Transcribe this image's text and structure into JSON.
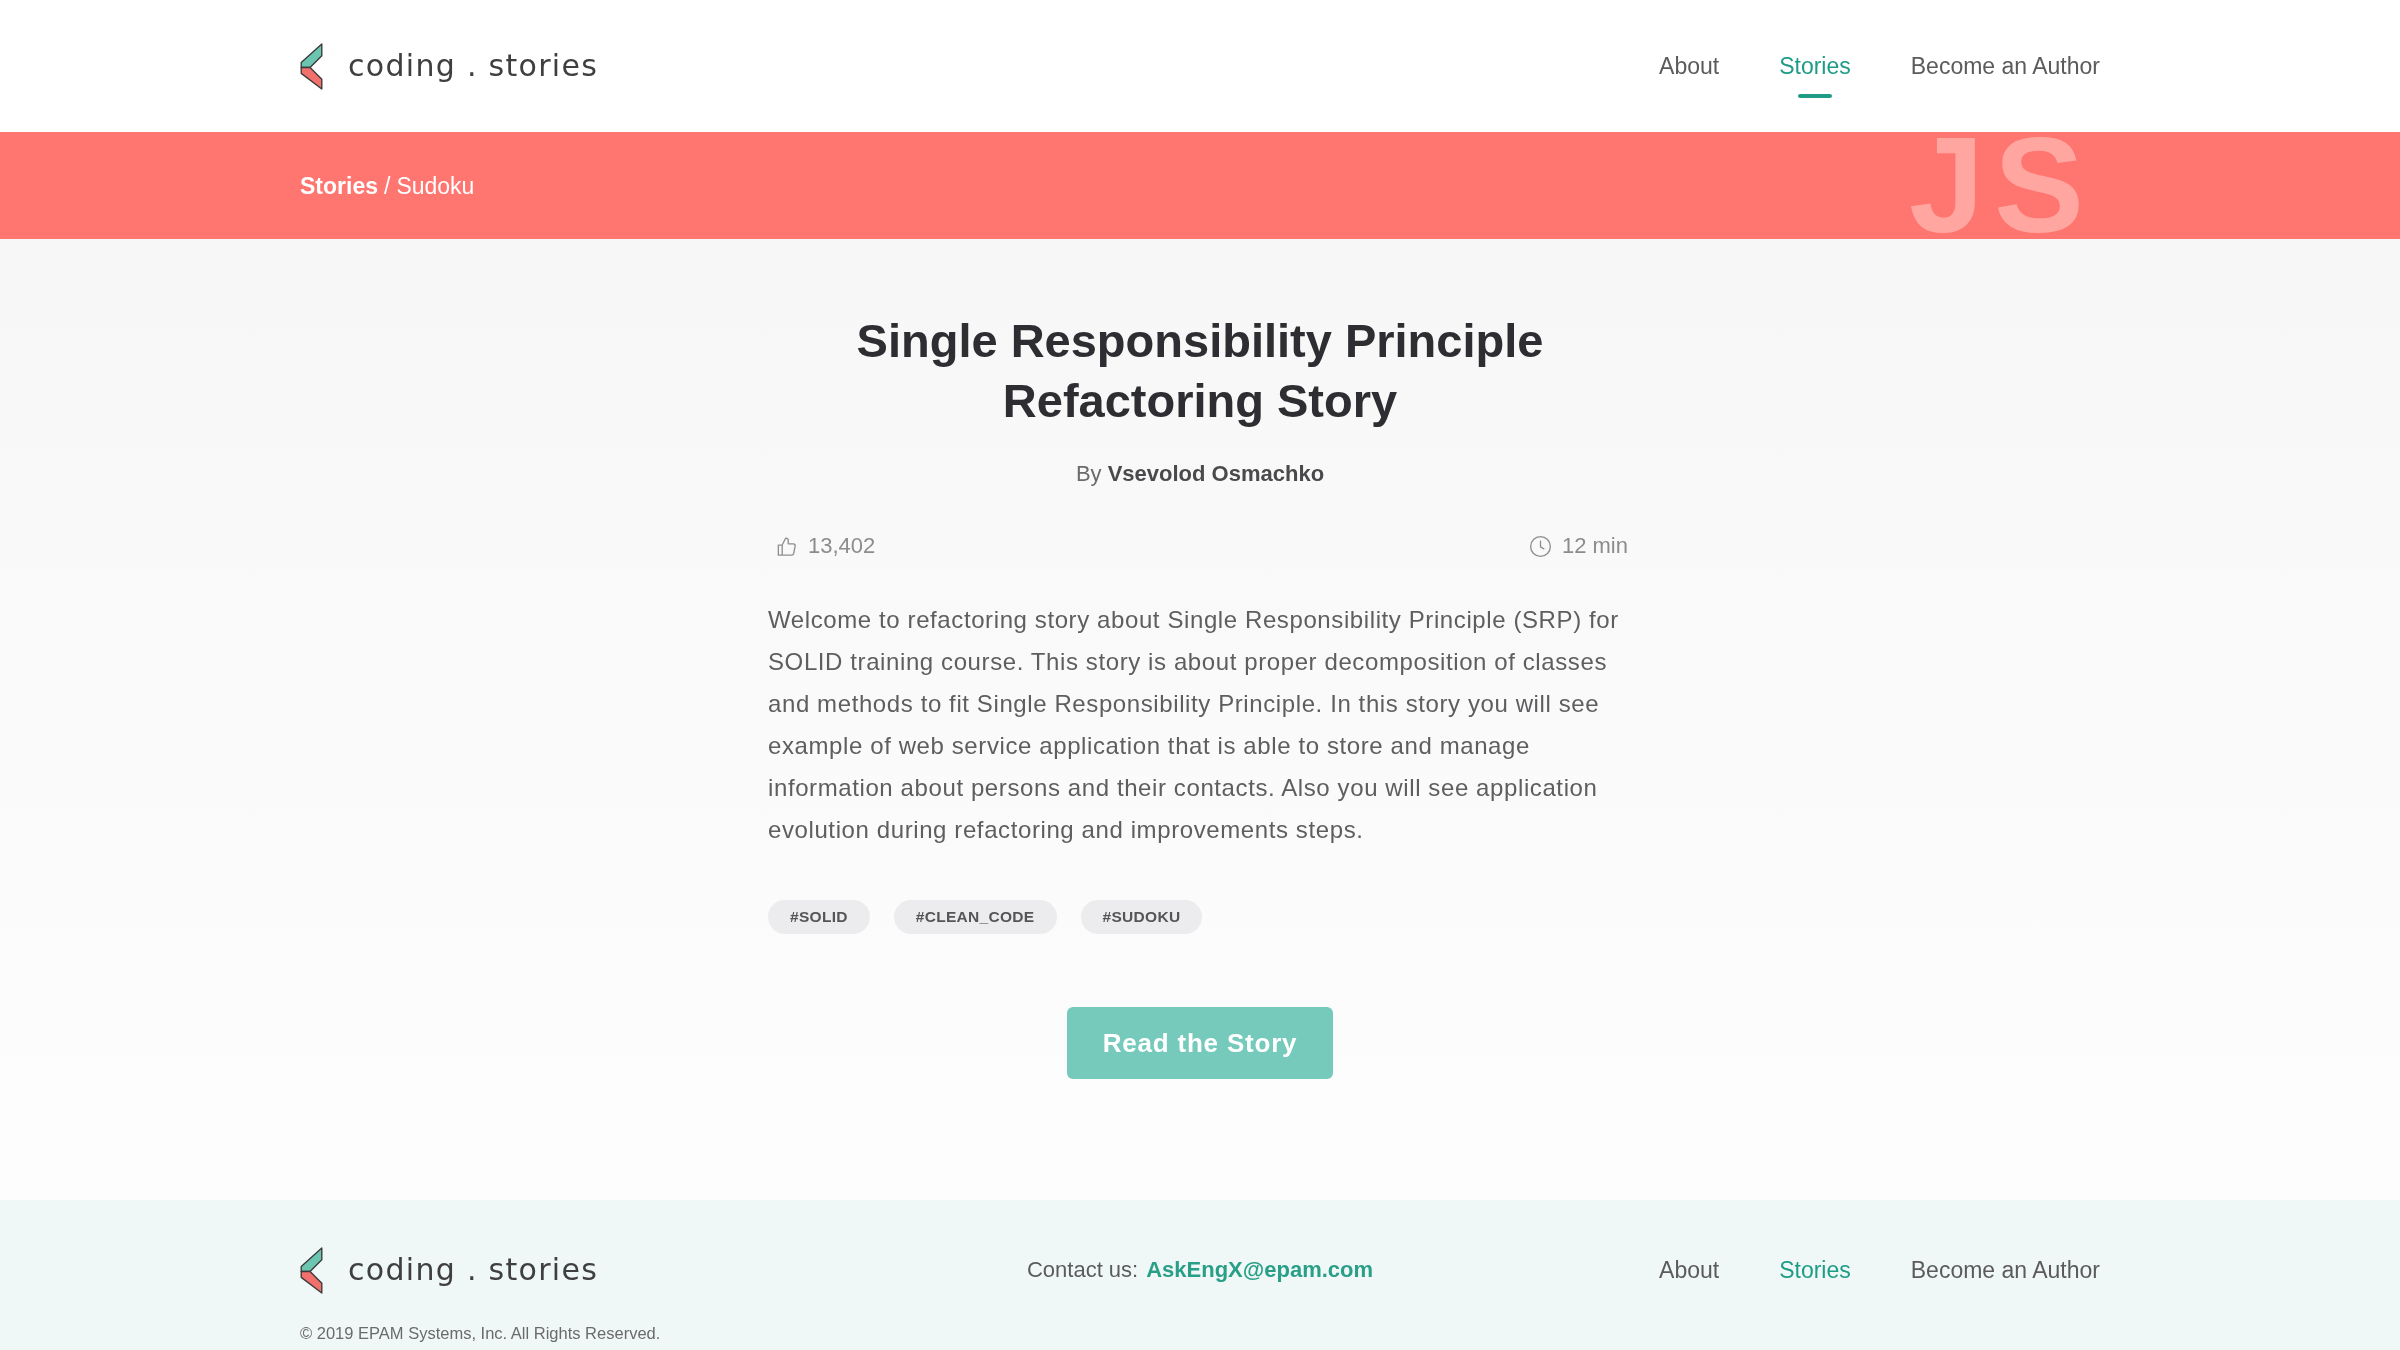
{
  "header": {
    "logo_text": "coding . stories",
    "nav": [
      {
        "label": "About",
        "selected": false
      },
      {
        "label": "Stories",
        "selected": true
      },
      {
        "label": "Become an Author",
        "selected": false
      }
    ]
  },
  "banner": {
    "breadcrumb": [
      {
        "label": "Stories",
        "current": false
      },
      {
        "label": "Sudoku",
        "current": true
      }
    ],
    "separator": "/",
    "language_mark": "JS"
  },
  "story": {
    "title": "Single Responsibility Principle Refactoring Story",
    "byline": "By **Vsevolod Osmachko**",
    "likes": "13,402",
    "read_time": "12 min",
    "description": "Welcome to refactoring story about Single Responsibility Principle (SRP) for SOLID training course. This story is about proper decomposition of classes and methods to fit Single Responsibility Principle. In this story you will see example of web service application that is able to store and manage information about persons and their contacts. Also you will see application evolution during refactoring and improvements steps.",
    "tags": [
      "#SOLID",
      "#CLEAN_CODE",
      "#SUDOKU"
    ],
    "read_button": "Read the Story"
  },
  "footer": {
    "logo_text": "coding . stories",
    "contact_label": "Contact us:",
    "contact_email": "AskEngX@epam.com",
    "nav": [
      {
        "label": "About",
        "selected": false
      },
      {
        "label": "Stories",
        "selected": true
      },
      {
        "label": "Become an Author",
        "selected": false
      }
    ],
    "copyright": "© 2019 EPAM Systems, Inc. All Rights Reserved."
  }
}
